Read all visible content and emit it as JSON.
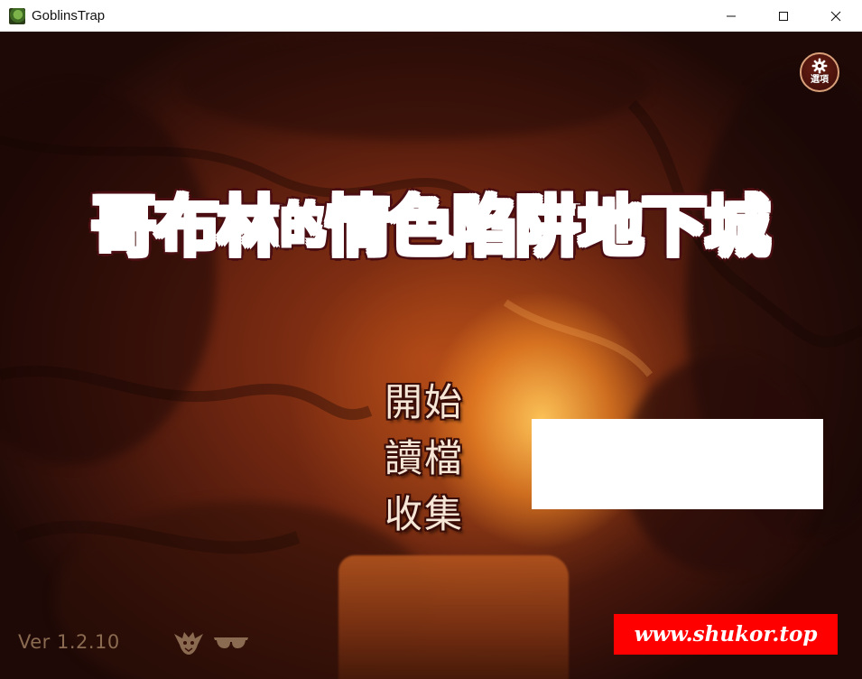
{
  "window": {
    "title": "GoblinsTrap",
    "controls": {
      "minimize": "minimize-icon",
      "maximize": "maximize-icon",
      "close": "close-icon"
    }
  },
  "game": {
    "logo": {
      "part_green": "哥布林",
      "part_small": "的",
      "part_pink": "情色陷阱",
      "part_gold": "地下城"
    },
    "options": {
      "label": "選項",
      "icon": "gear-icon"
    },
    "menu": {
      "start": "開始",
      "load": "讀檔",
      "collection": "收集"
    },
    "version": "Ver 1.2.10",
    "bottom_icons": [
      "goblin-icon",
      "sunglasses-icon"
    ]
  },
  "watermark": "www.shukor.top",
  "colors": {
    "logo_green": "#4a9a2a",
    "logo_pink": "#ff6ab0",
    "logo_gold": "#f2c98a",
    "logo_outline": "#4a0e12",
    "menu_text": "#f6e6d6",
    "watermark_bg": "#ff0000"
  }
}
